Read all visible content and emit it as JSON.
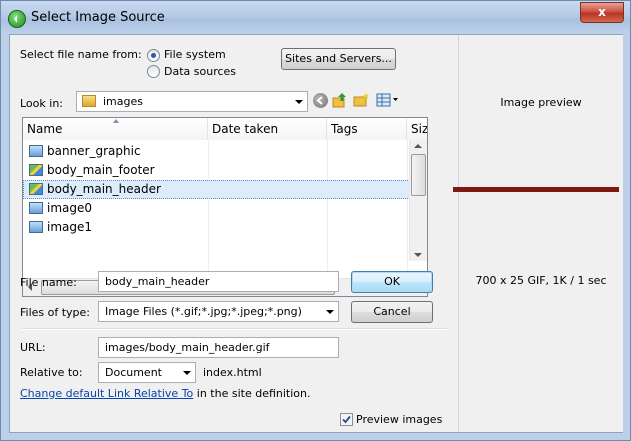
{
  "window": {
    "title": "Select Image Source",
    "close_label": "x"
  },
  "source": {
    "label": "Select file name from:",
    "options": [
      "File system",
      "Data sources"
    ],
    "selected": "File system",
    "sites_button": "Sites and Servers..."
  },
  "look_in": {
    "label": "Look in:",
    "value": "images"
  },
  "file_list": {
    "columns": [
      "Name",
      "Date taken",
      "Tags",
      "Size"
    ],
    "items": [
      {
        "name": "banner_graphic",
        "icon": "image-file-icon"
      },
      {
        "name": "body_main_footer",
        "icon": "picture-file-icon"
      },
      {
        "name": "body_main_header",
        "icon": "picture-file-icon",
        "selected": true
      },
      {
        "name": "image0",
        "icon": "image-file-icon"
      },
      {
        "name": "image1",
        "icon": "image-file-icon"
      }
    ],
    "scroll_mark": "III"
  },
  "file_name": {
    "label": "File name:",
    "value": "body_main_header"
  },
  "file_type": {
    "label": "Files of type:",
    "value": "Image Files (*.gif;*.jpg;*.jpeg;*.png)"
  },
  "buttons": {
    "ok": "OK",
    "cancel": "Cancel"
  },
  "url": {
    "label": "URL:",
    "value": "images/body_main_header.gif"
  },
  "relative_to": {
    "label": "Relative to:",
    "value": "Document",
    "file": "index.html"
  },
  "link_row": {
    "link_text": "Change default Link Relative To",
    "suffix": " in the site definition."
  },
  "preview": {
    "title": "Image preview",
    "info": "700 x 25 GIF, 1K / 1 sec",
    "checkbox_label": "Preview images",
    "checkbox_checked": true,
    "bar_color": "#7a1a12"
  },
  "colors": {
    "accent": "#3c7fb1",
    "selection": "#ddecfb",
    "link": "#0645ad"
  }
}
